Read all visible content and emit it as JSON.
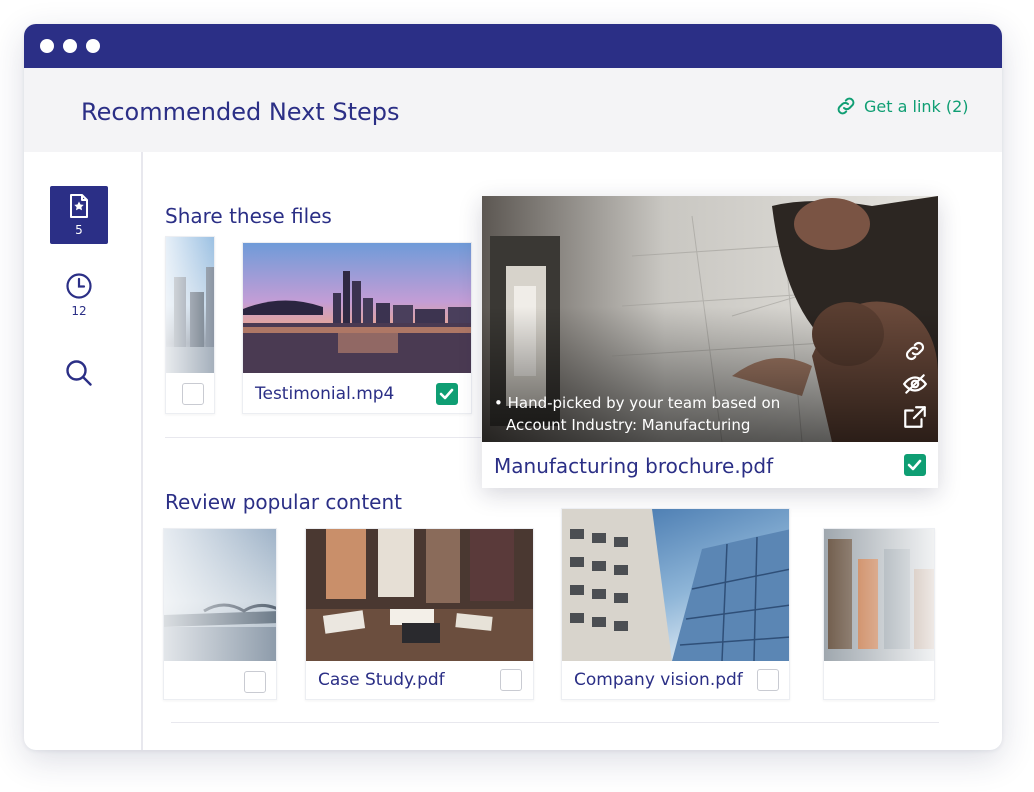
{
  "colors": {
    "brand": "#2b2f86",
    "accent": "#0f9e73",
    "header_bg": "#f4f4f6"
  },
  "header": {
    "title": "Recommended Next Steps",
    "get_link_label": "Get a link (2)"
  },
  "sidebar": {
    "items": [
      {
        "icon": "starred-file-icon",
        "count": "5",
        "active": true
      },
      {
        "icon": "clock-icon",
        "count": "12",
        "active": false
      },
      {
        "icon": "search-icon",
        "active": false
      }
    ]
  },
  "share_section": {
    "title": "Share these files",
    "cards": [
      {
        "label": "",
        "checked": false
      },
      {
        "label": "Testimonial.mp4",
        "checked": true
      }
    ]
  },
  "popup": {
    "caption_line1": "• Hand-picked by your team based on",
    "caption_line2": "Account Industry: Manufacturing",
    "label": "Manufacturing brochure.pdf",
    "checked": true,
    "overlay_icons": [
      "link-icon",
      "hide-icon",
      "external-link-icon"
    ]
  },
  "review_section": {
    "title": "Review popular content",
    "cards": [
      {
        "label": "",
        "checked": false
      },
      {
        "label": "Case Study.pdf",
        "checked": false
      },
      {
        "label": "Company vision.pdf",
        "checked": false
      },
      {
        "label": "",
        "checked": false
      }
    ]
  }
}
